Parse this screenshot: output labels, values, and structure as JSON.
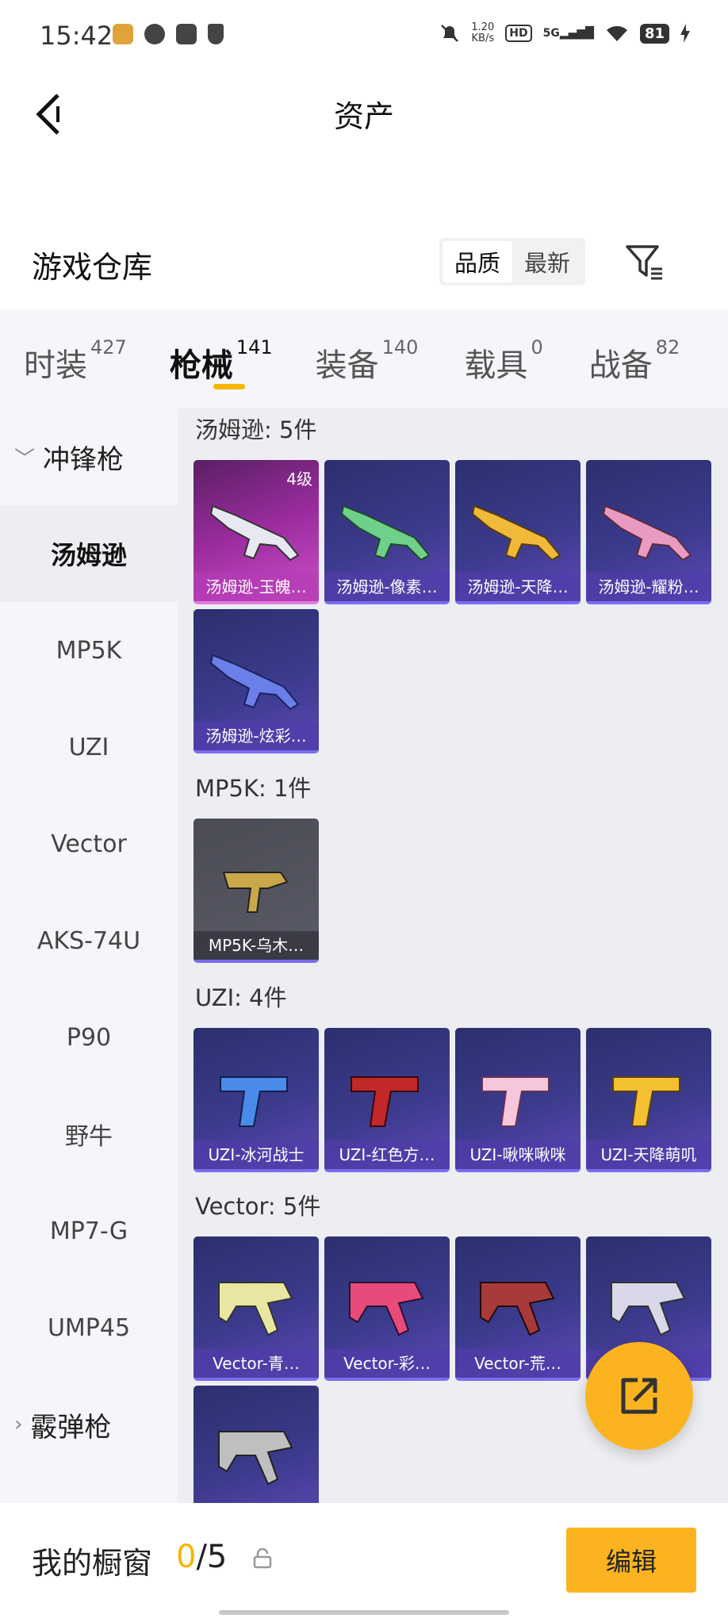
{
  "status_bar": {
    "time": "15:42",
    "speed": "1.20\nKB/s",
    "hd": "HD",
    "network": "5G",
    "battery": "81"
  },
  "nav": {
    "title": "资产",
    "back_icon": "chevron-left-icon"
  },
  "header": {
    "title": "游戏仓库",
    "sort_options": [
      "品质",
      "最新"
    ],
    "active_sort": "品质",
    "filter_icon": "filter-icon"
  },
  "tabs": [
    {
      "label": "时装",
      "count": "427"
    },
    {
      "label": "枪械",
      "count": "141"
    },
    {
      "label": "装备",
      "count": "140"
    },
    {
      "label": "载具",
      "count": "0"
    },
    {
      "label": "战备",
      "count": "82"
    }
  ],
  "active_tab": "枪械",
  "sidebar": {
    "group_submachine": "冲锋枪",
    "items": [
      "汤姆逊",
      "MP5K",
      "UZI",
      "Vector",
      "AKS-74U",
      "P90",
      "野牛",
      "MP7-G",
      "UMP45"
    ],
    "active_item": "汤姆逊",
    "group_shotgun": "霰弹枪"
  },
  "sections": [
    {
      "title": "汤姆逊: 5件",
      "cards": [
        {
          "name": "汤姆逊-玉魄…",
          "level": "4级"
        },
        {
          "name": "汤姆逊-像素…"
        },
        {
          "name": "汤姆逊-天降…"
        },
        {
          "name": "汤姆逊-耀粉…"
        },
        {
          "name": "汤姆逊-炫彩…"
        }
      ]
    },
    {
      "title": "MP5K: 1件",
      "cards": [
        {
          "name": "MP5K-乌木…"
        }
      ]
    },
    {
      "title": "UZI: 4件",
      "cards": [
        {
          "name": "UZI-冰河战士"
        },
        {
          "name": "UZI-红色方…"
        },
        {
          "name": "UZI-啾咪啾咪"
        },
        {
          "name": "UZI-天降萌叽"
        }
      ]
    },
    {
      "title": "Vector: 5件",
      "cards": [
        {
          "name": "Vector-青…"
        },
        {
          "name": "Vector-彩…"
        },
        {
          "name": "Vector-荒…"
        },
        {
          "name": "…"
        }
      ]
    }
  ],
  "fab": {
    "icon": "share-icon"
  },
  "bottom_bar": {
    "label": "我的橱窗",
    "count_current": "0",
    "count_sep_total": "/5",
    "lock_icon": "lock-icon",
    "edit_label": "编辑"
  },
  "colors": {
    "accent": "#fbb41f",
    "card_purple": "#3b3a8c",
    "card_pink": "#9b2c9f"
  }
}
